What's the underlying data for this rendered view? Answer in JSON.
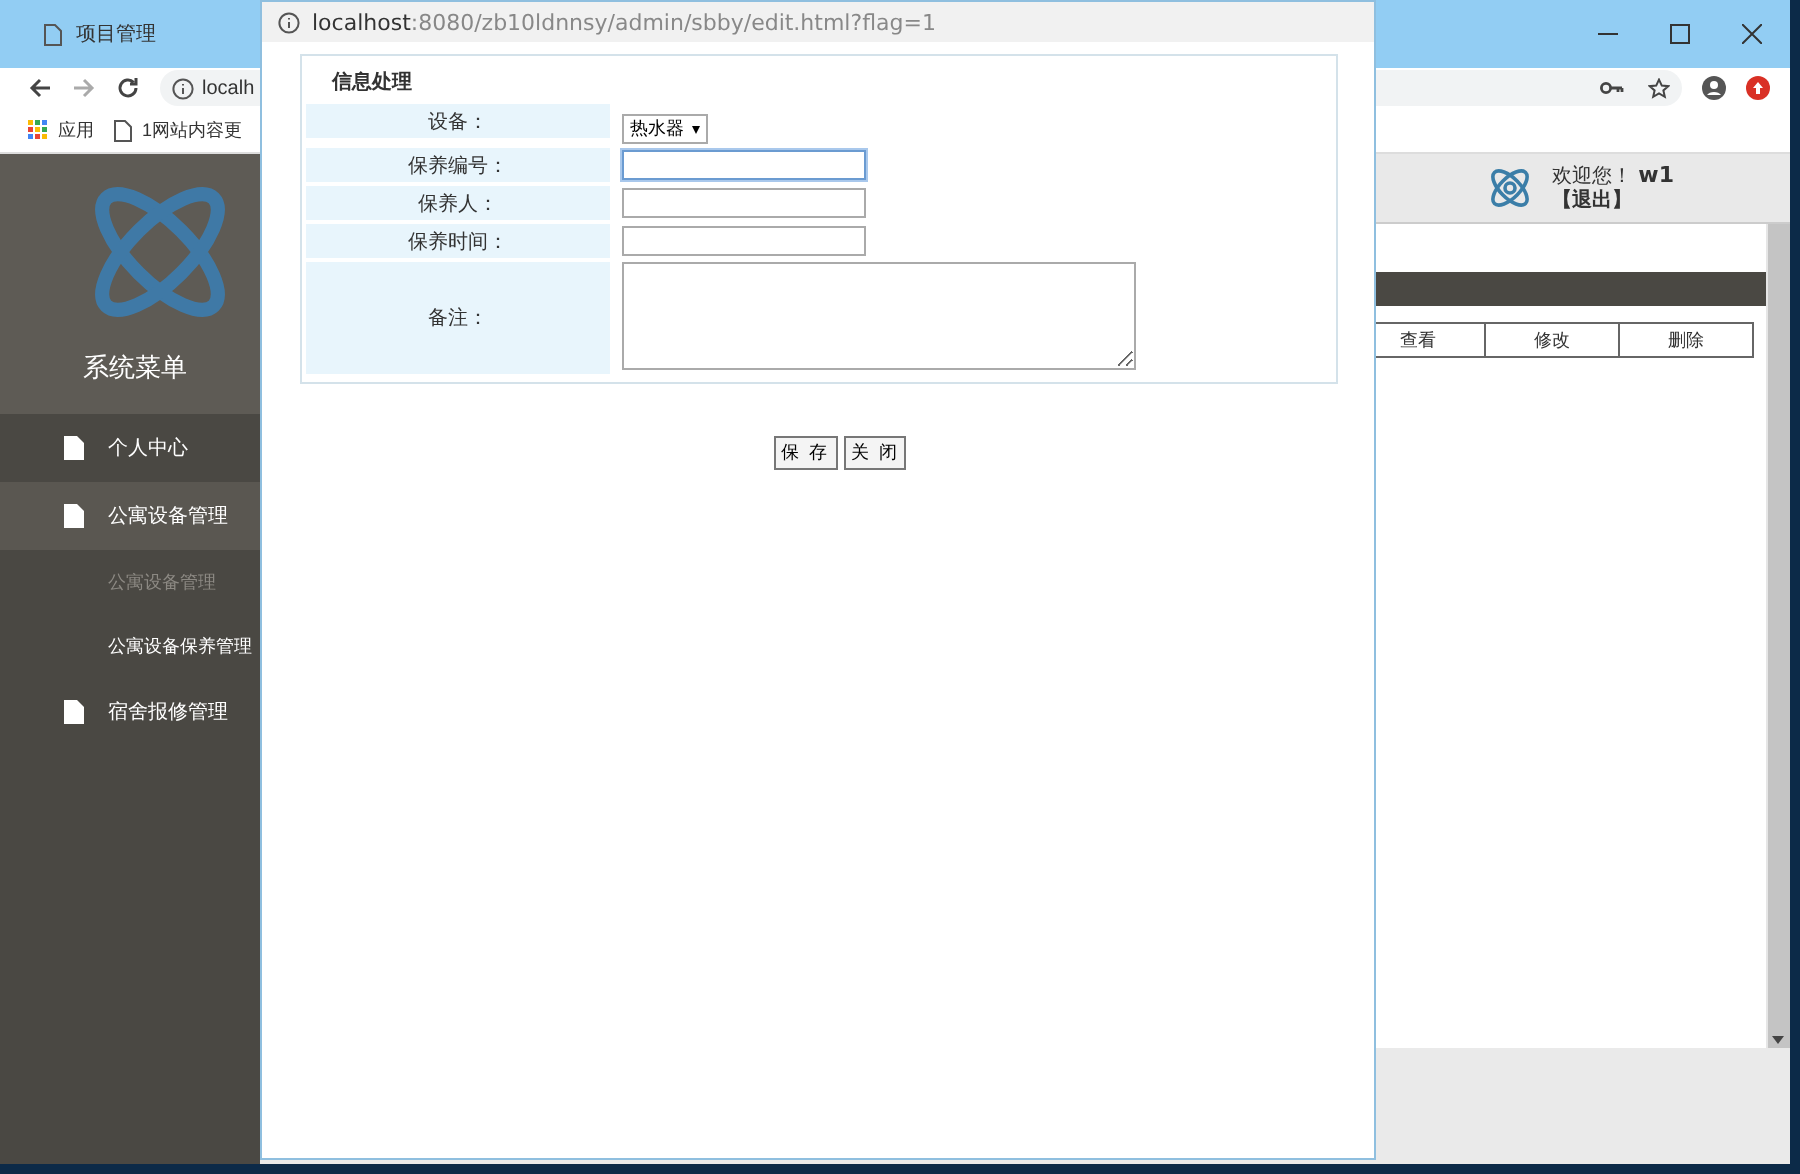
{
  "browser": {
    "tab_title": "项目管理",
    "address": "localh",
    "bookmarks": [
      {
        "label": "应用",
        "kind": "apps"
      },
      {
        "label": "1网站内容更",
        "kind": "page"
      }
    ]
  },
  "sidebar": {
    "title": "系统菜单",
    "items": [
      {
        "label": "个人中心",
        "selected": false
      },
      {
        "label": "公寓设备管理",
        "selected": true,
        "children": [
          {
            "label": "公寓设备管理",
            "selected": true
          },
          {
            "label": "公寓设备保养管理",
            "selected": false
          }
        ]
      },
      {
        "label": "宿舍报修管理",
        "selected": false
      }
    ]
  },
  "header": {
    "welcome": "欢迎您！",
    "user": "w1",
    "logout": "【退出】"
  },
  "table": {
    "columns": [
      "查看",
      "修改",
      "删除"
    ]
  },
  "dialog": {
    "address_host": "localhost",
    "address_path": ":8080/zb10ldnnsy/admin/sbby/edit.html?flag=1",
    "title": "信息处理",
    "fields": [
      {
        "label": "设备：",
        "kind": "select",
        "value": "热水器",
        "focused": false
      },
      {
        "label": "保养编号：",
        "kind": "text",
        "focused": true
      },
      {
        "label": "保养人：",
        "kind": "text",
        "focused": false
      },
      {
        "label": "保养时间：",
        "kind": "text",
        "focused": false
      },
      {
        "label": "备注：",
        "kind": "textarea",
        "focused": false
      }
    ],
    "buttons": [
      "保 存",
      "关 闭"
    ]
  }
}
